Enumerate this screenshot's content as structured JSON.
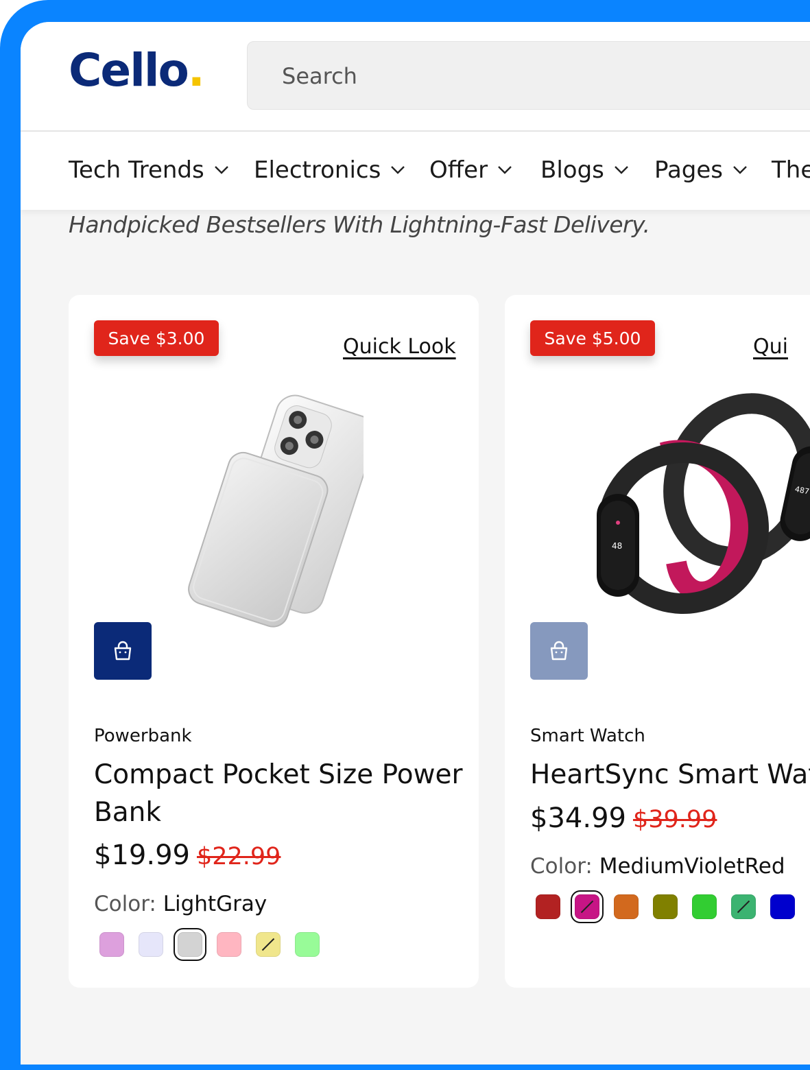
{
  "brand": {
    "name": "Cello",
    "dot": ".",
    "colors": {
      "primary": "#0b2a78",
      "accent": "#f5c400",
      "frame": "#0a84ff",
      "sale": "#e0251b"
    }
  },
  "search": {
    "placeholder": "Search"
  },
  "nav": {
    "items": [
      {
        "label": "Tech Trends"
      },
      {
        "label": "Electronics"
      },
      {
        "label": "Offer"
      },
      {
        "label": "Blogs"
      },
      {
        "label": "Pages"
      },
      {
        "label": "The"
      }
    ]
  },
  "tagline": "Handpicked Bestsellers With Lightning-Fast Delivery.",
  "products": [
    {
      "badge": "Save $3.00",
      "quick_look": "Quick Look",
      "category": "Powerbank",
      "title": "Compact Pocket Size Power Bank",
      "price": "$19.99",
      "old_price": "$22.99",
      "color_label": "Color:",
      "color_value": "LightGray",
      "cart_icon": "shopping-bag-icon",
      "swatches": [
        "#dda0dd",
        "#e6e6fa",
        "#d3d3d3",
        "#ffb6c1",
        "#f0e68c",
        "#98fb98"
      ]
    },
    {
      "badge": "Save $5.00",
      "quick_look": "Qui",
      "category": "Smart Watch",
      "title": "HeartSync Smart Watc",
      "price": "$34.99",
      "old_price": "$39.99",
      "color_label": "Color:",
      "color_value": "MediumVioletRed",
      "cart_icon": "shopping-bag-icon",
      "swatches": [
        "#b22222",
        "#c71585",
        "#d2691e",
        "#808000",
        "#32cd32",
        "#3cb371",
        "#0000cd"
      ]
    }
  ]
}
